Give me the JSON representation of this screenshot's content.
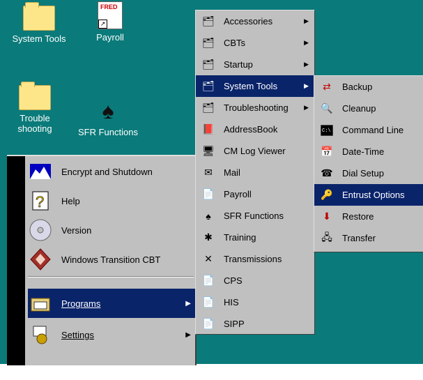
{
  "desktop": {
    "icons": [
      {
        "label": "System Tools"
      },
      {
        "label": "Payroll",
        "badge": "FRED"
      },
      {
        "label": "Trouble shooting"
      },
      {
        "label": "SFR Functions"
      }
    ]
  },
  "start_menu": {
    "items": [
      {
        "label": "Encrypt and Shutdown",
        "icon": "mountain-icon"
      },
      {
        "label": "Help",
        "icon": "help-icon"
      },
      {
        "label": "Version",
        "icon": "cd-icon"
      },
      {
        "label": "Windows Transition CBT",
        "icon": "diamond-icon"
      },
      {
        "label": "Programs",
        "icon": "programs-folder-icon",
        "selected": true
      },
      {
        "label": "Settings",
        "icon": "settings-icon"
      }
    ]
  },
  "programs_menu": {
    "items": [
      {
        "label": "Accessories",
        "submenu": true
      },
      {
        "label": "CBTs",
        "submenu": true
      },
      {
        "label": "Startup",
        "submenu": true
      },
      {
        "label": "System Tools",
        "submenu": true,
        "selected": true
      },
      {
        "label": "Troubleshooting",
        "submenu": true
      },
      {
        "label": "AddressBook"
      },
      {
        "label": "CM Log Viewer"
      },
      {
        "label": "Mail"
      },
      {
        "label": "Payroll"
      },
      {
        "label": "SFR Functions"
      },
      {
        "label": "Training"
      },
      {
        "label": "Transmissions"
      },
      {
        "label": "CPS"
      },
      {
        "label": "HIS"
      },
      {
        "label": "SIPP"
      }
    ]
  },
  "system_tools_menu": {
    "items": [
      {
        "label": "Backup"
      },
      {
        "label": "Cleanup"
      },
      {
        "label": "Command Line"
      },
      {
        "label": "Date-Time"
      },
      {
        "label": "Dial Setup"
      },
      {
        "label": "Entrust Options",
        "selected": true
      },
      {
        "label": "Restore"
      },
      {
        "label": "Transfer"
      }
    ]
  },
  "colors": {
    "desktop": "#0a7a7a",
    "menu": "#c0c0c0",
    "selection": "#0a246a"
  }
}
